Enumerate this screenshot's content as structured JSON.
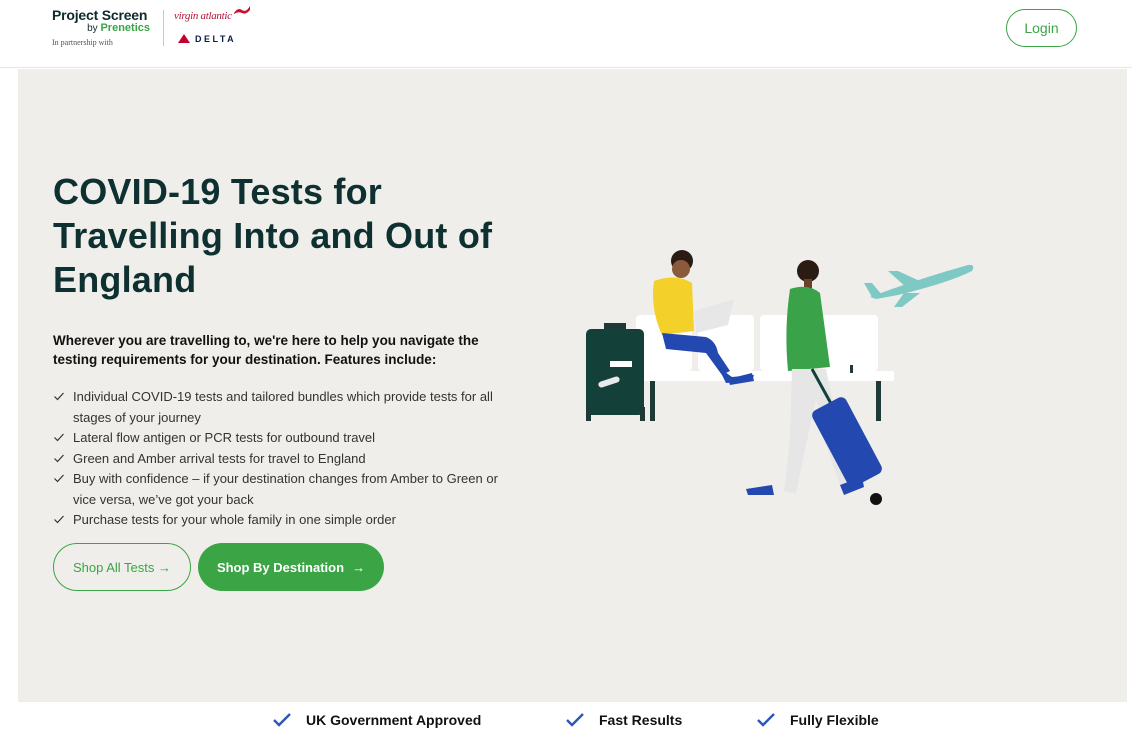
{
  "header": {
    "brand_title": "Project Screen",
    "brand_by": "by",
    "brand_company": "Prenetics",
    "brand_partner": "In partnership with",
    "partner_one": "virgin atlantic",
    "partner_two": "DELTA",
    "login_label": "Login"
  },
  "hero": {
    "title": "COVID-19 Tests for Travelling Into and Out of England",
    "intro": "Wherever you are travelling to, we're here to help you navigate the testing requirements for your destination. Features include:",
    "features": [
      "Individual COVID-19 tests and tailored bundles which provide tests for all stages of your journey",
      "Lateral flow antigen or PCR tests for outbound travel",
      "Green and Amber arrival tests for travel to England",
      "Buy with confidence – if your destination changes from Amber to Green or vice versa, we’ve got your back",
      "Purchase tests for your whole family in one simple order"
    ],
    "shop_all_label": "Shop All Tests →",
    "shop_destination_label": "Shop By Destination",
    "shop_destination_arrow": "→"
  },
  "badges": [
    "UK Government Approved",
    "Fast Results",
    "Fully Flexible"
  ],
  "colors": {
    "brand_green": "#3ba546",
    "hero_bg": "#efeeea",
    "heading": "#0f3030",
    "check_blue": "#2b58b8"
  }
}
